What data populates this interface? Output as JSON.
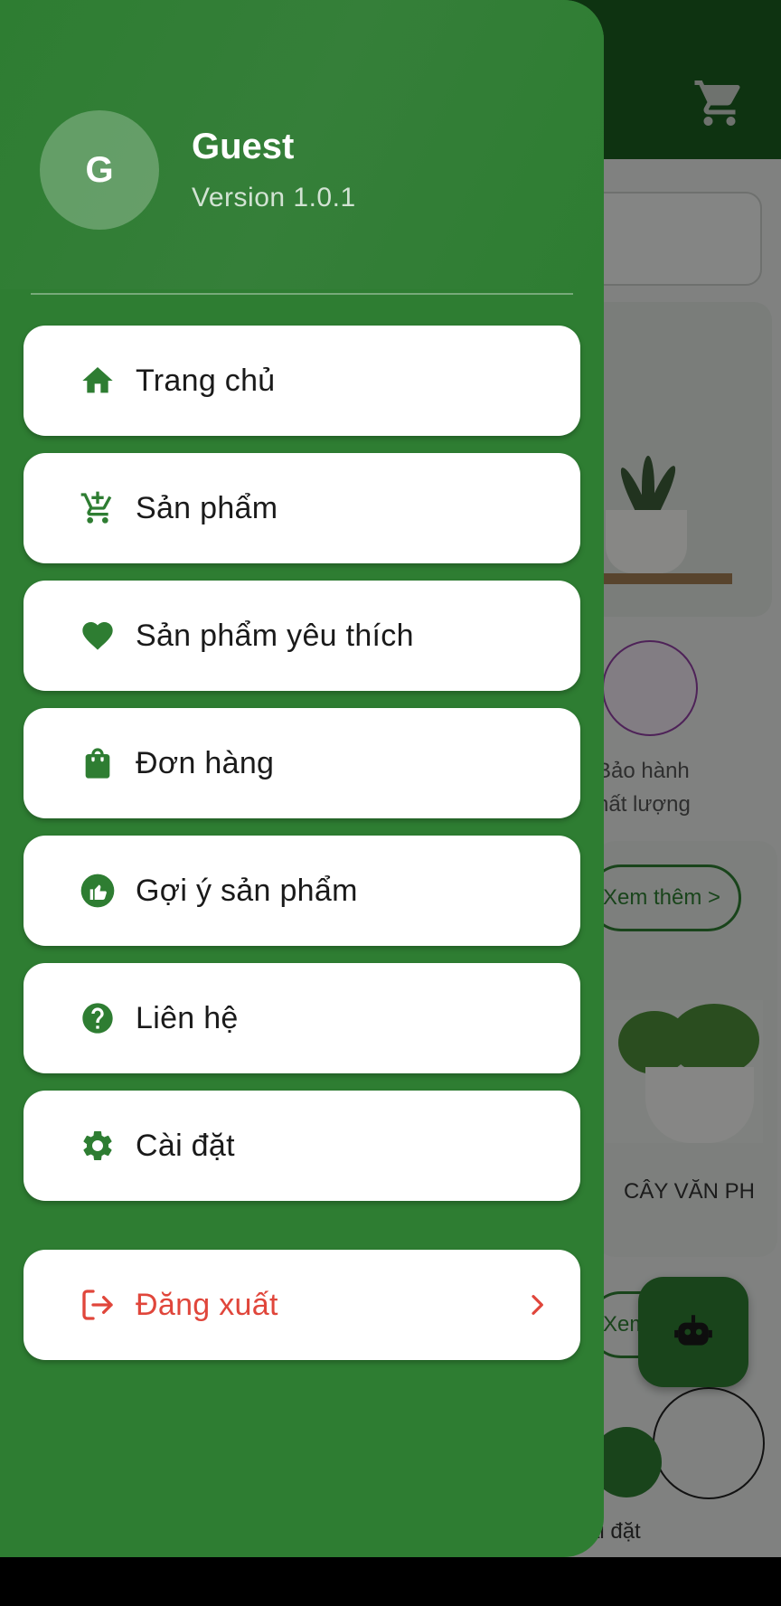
{
  "background": {
    "feature_text_line1": "Bảo hành",
    "feature_text_line2": "hất lượng",
    "more_label": "Xem thêm >",
    "more_label2": "Xem",
    "product_name": "CÂY VĂN PH",
    "nav_settings_label": "ài đặt"
  },
  "drawer": {
    "avatar_letter": "G",
    "user_name": "Guest",
    "version": "Version 1.0.1",
    "menu": [
      {
        "label": "Trang chủ",
        "icon": "home-icon"
      },
      {
        "label": "Sản phẩm",
        "icon": "shopping-cart-icon"
      },
      {
        "label": "Sản phẩm yêu thích",
        "icon": "heart-icon"
      },
      {
        "label": "Đơn hàng",
        "icon": "shopping-bag-icon"
      },
      {
        "label": "Gợi ý sản phẩm",
        "icon": "thumbs-up-icon"
      },
      {
        "label": "Liên hệ",
        "icon": "help-icon"
      },
      {
        "label": "Cài đặt",
        "icon": "settings-icon"
      }
    ],
    "logout_label": "Đăng xuất"
  },
  "colors": {
    "primary": "#2e7d32",
    "primary_dark": "#1b5e20",
    "logout": "#e0463b"
  }
}
